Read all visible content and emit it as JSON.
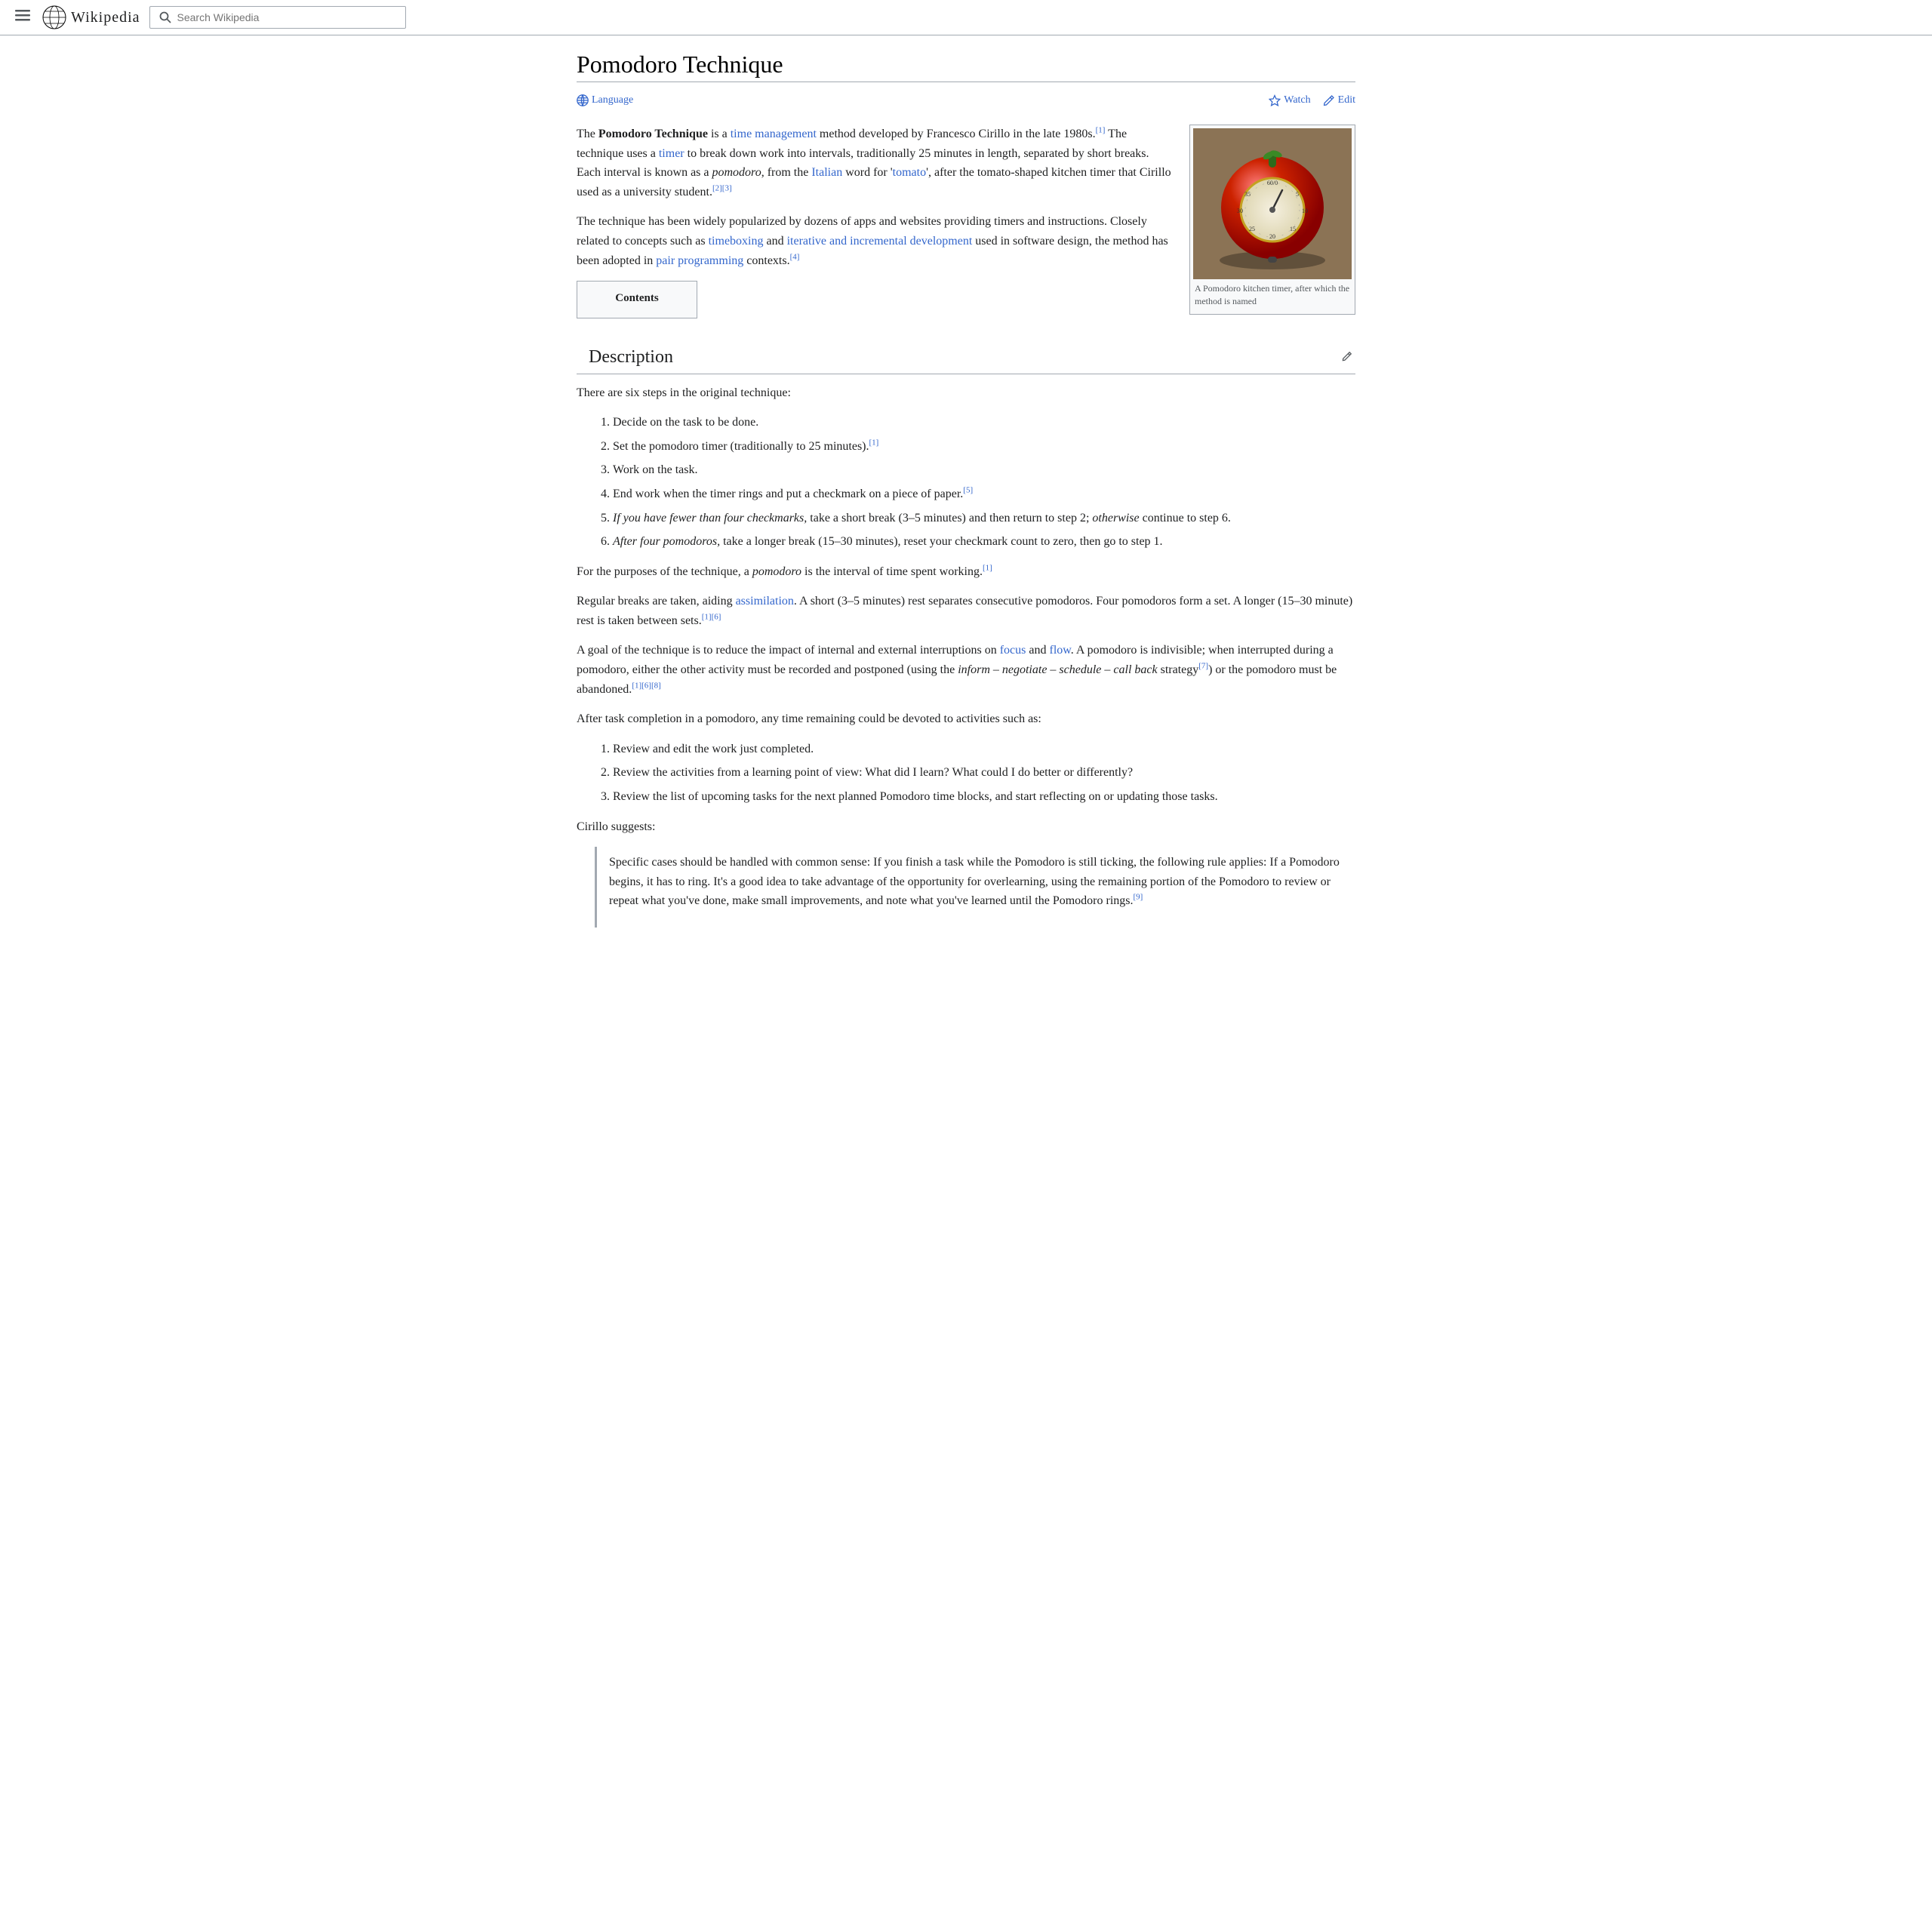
{
  "header": {
    "menu_label": "Menu",
    "logo_text": "Wikipedia",
    "search_placeholder": "Search Wikipedia"
  },
  "page": {
    "title": "Pomodoro Technique",
    "action_language": "Language",
    "action_watch": "Watch",
    "action_edit": "Edit"
  },
  "article": {
    "intro_p1": "The Pomodoro Technique is a time management method developed by Francesco Cirillo in the late 1980s.[1] The technique uses a timer to break down work into intervals, traditionally 25 minutes in length, separated by short breaks. Each interval is known as a pomodoro, from the Italian word for 'tomato', after the tomato-shaped kitchen timer that Cirillo used as a university student.[2][3]",
    "intro_p2_prefix": "The technique has been widely popularized by dozens of apps and websites providing timers and instructions. Closely related to concepts such as ",
    "intro_p2_link1": "timeboxing",
    "intro_p2_mid": " and ",
    "intro_p2_link2": "iterative and incremental development",
    "intro_p2_suffix": " used in software design, the method has been adopted in ",
    "intro_p2_link3": "pair programming",
    "intro_p2_end": " contexts.[4]",
    "contents_title": "Contents",
    "section1_title": "Description",
    "section1_intro": "There are six steps in the original technique:",
    "steps": [
      "Decide on the task to be done.",
      "Set the pomodoro timer (traditionally to 25 minutes).[1]",
      "Work on the task.",
      "End work when the timer rings and put a checkmark on a piece of paper.[5]",
      "If you have fewer than four checkmarks, take a short break (3–5 minutes) and then return to step 2; otherwise continue to step 6.",
      "After four pomodoros, take a longer break (15–30 minutes), reset your checkmark count to zero, then go to step 1."
    ],
    "p_pomodoro": "For the purposes of the technique, a pomodoro is the interval of time spent working.[1]",
    "p_breaks": "Regular breaks are taken, aiding assimilation. A short (3–5 minutes) rest separates consecutive pomodoros. Four pomodoros form a set. A longer (15–30 minute) rest is taken between sets.[1][6]",
    "p_interruptions": "A goal of the technique is to reduce the impact of internal and external interruptions on focus and flow. A pomodoro is indivisible; when interrupted during a pomodoro, either the other activity must be recorded and postponed (using the inform – negotiate – schedule – call back strategy[7]) or the pomodoro must be abandoned.[1][6][8]",
    "p_completion": "After task completion in a pomodoro, any time remaining could be devoted to activities such as:",
    "completion_steps": [
      "Review and edit the work just completed.",
      "Review the activities from a learning point of view: What did I learn? What could I do better or differently?",
      "Review the list of upcoming tasks for the next planned Pomodoro time blocks, and start reflecting on or updating those tasks."
    ],
    "cirillo_suggests": "Cirillo suggests:",
    "blockquote": "Specific cases should be handled with common sense: If you finish a task while the Pomodoro is still ticking, the following rule applies: If a Pomodoro begins, it has to ring. It's a good idea to take advantage of the opportunity for overlearning, using the remaining portion of the Pomodoro to review or repeat what you've done, make small improvements, and note what you've learned until the Pomodoro rings.[9]",
    "image_caption": "A Pomodoro kitchen timer, after which the method is named"
  }
}
